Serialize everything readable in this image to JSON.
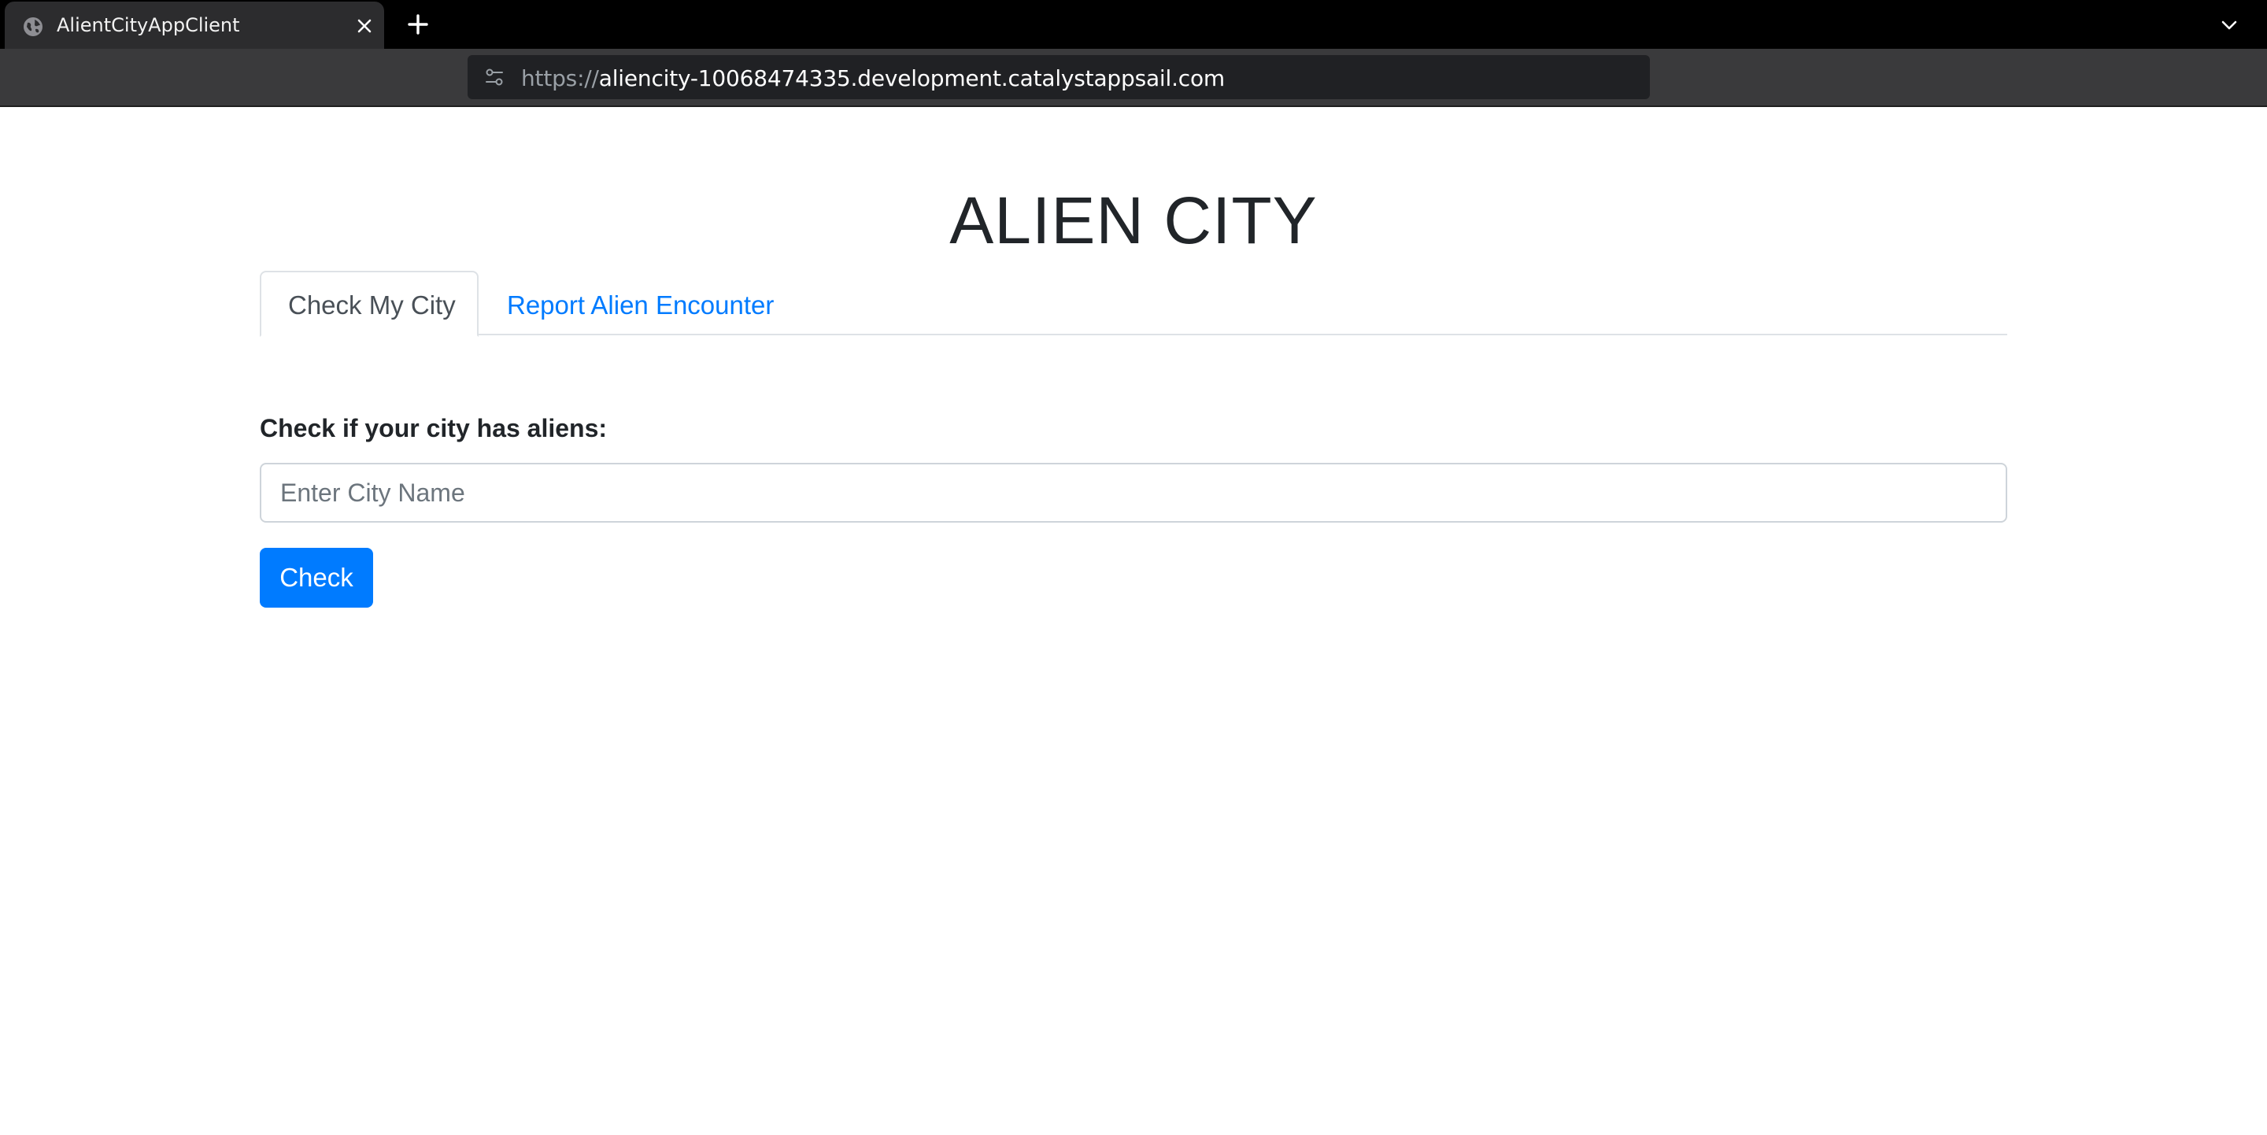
{
  "browser": {
    "tab": {
      "title": "AlientCityAppClient",
      "favicon": "globe-icon"
    },
    "new_tab_icon": "plus-icon",
    "tab_list_icon": "chevron-down-icon",
    "address_bar": {
      "scheme": "https://",
      "host_path": "aliencity-10068474335.development.catalystappsail.com",
      "site_info_icon": "tune-icon"
    }
  },
  "page": {
    "title": "ALIEN CITY",
    "tabs": [
      {
        "label": "Check My City",
        "active": true
      },
      {
        "label": "Report Alien Encounter",
        "active": false
      }
    ],
    "form": {
      "label": "Check if your city has aliens:",
      "input_placeholder": "Enter City Name",
      "input_value": "",
      "submit_label": "Check"
    }
  },
  "colors": {
    "primary": "#007bff",
    "text": "#212529",
    "border": "#dee2e6",
    "chrome_bg": "#000000",
    "toolbar_bg": "#3a3a3c"
  }
}
